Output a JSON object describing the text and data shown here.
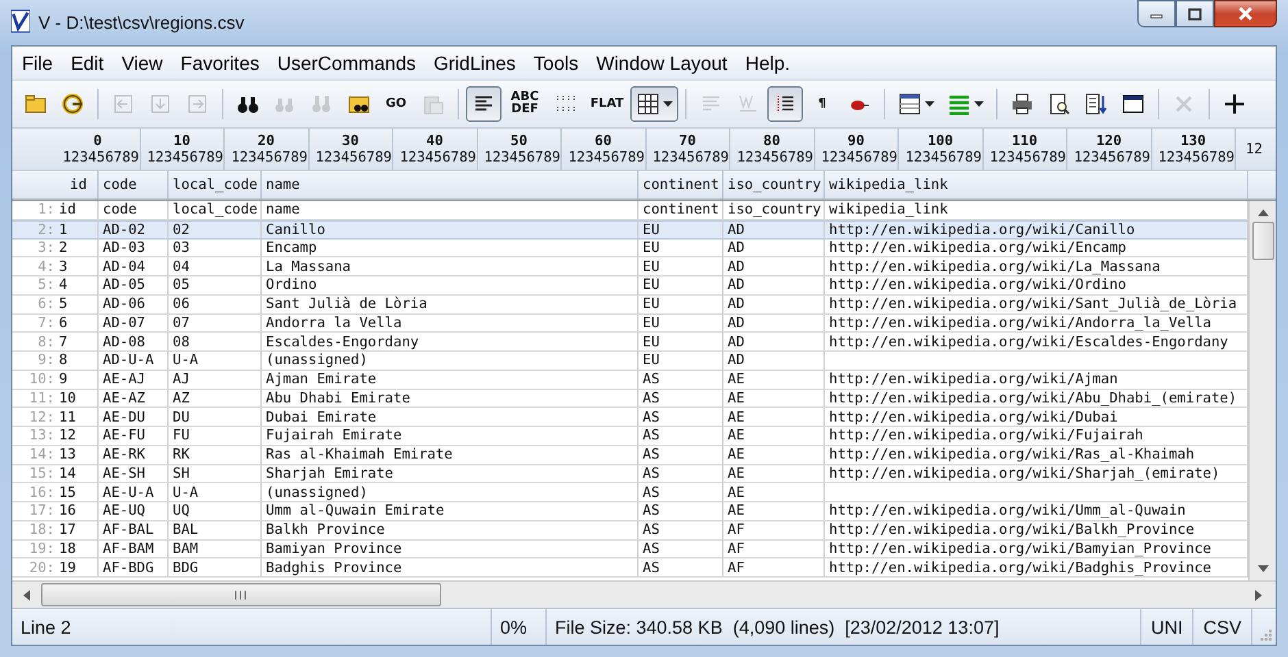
{
  "window": {
    "title": "V - D:\\test\\csv\\regions.csv"
  },
  "menu": [
    "File",
    "Edit",
    "View",
    "Favorites",
    "UserCommands",
    "GridLines",
    "Tools",
    "Window Layout",
    "Help."
  ],
  "toolbar": [
    {
      "kind": "icon",
      "disabled": false,
      "pressed": false
    },
    {
      "kind": "icon",
      "disabled": false,
      "pressed": false
    },
    {
      "kind": "separator"
    },
    {
      "kind": "icon",
      "disabled": true,
      "pressed": false
    },
    {
      "kind": "icon",
      "disabled": true,
      "pressed": false
    },
    {
      "kind": "icon",
      "disabled": true,
      "pressed": false
    },
    {
      "kind": "separator"
    },
    {
      "kind": "icon",
      "disabled": false,
      "pressed": false
    },
    {
      "kind": "icon",
      "disabled": true,
      "pressed": false
    },
    {
      "kind": "icon",
      "disabled": true,
      "pressed": false
    },
    {
      "kind": "icon",
      "disabled": false,
      "pressed": false
    },
    {
      "kind": "text",
      "label": "GO",
      "disabled": false,
      "pressed": false
    },
    {
      "kind": "icon",
      "disabled": true,
      "pressed": false
    },
    {
      "kind": "separator"
    },
    {
      "kind": "icon",
      "disabled": false,
      "pressed": true
    },
    {
      "kind": "text",
      "label": "ABC DEF",
      "disabled": false,
      "pressed": false
    },
    {
      "kind": "icon",
      "disabled": false,
      "pressed": false
    },
    {
      "kind": "text",
      "label": "FLAT",
      "disabled": false,
      "pressed": false
    },
    {
      "kind": "dropdown",
      "disabled": false,
      "pressed": true
    },
    {
      "kind": "separator"
    },
    {
      "kind": "icon",
      "disabled": true,
      "pressed": false
    },
    {
      "kind": "icon",
      "disabled": true,
      "pressed": false
    },
    {
      "kind": "icon",
      "disabled": false,
      "pressed": true
    },
    {
      "kind": "text",
      "label": "¶",
      "disabled": false,
      "pressed": false
    },
    {
      "kind": "icon",
      "disabled": false,
      "pressed": false
    },
    {
      "kind": "separator"
    },
    {
      "kind": "dropdown",
      "disabled": false,
      "pressed": false
    },
    {
      "kind": "dropdown",
      "disabled": false,
      "pressed": false
    },
    {
      "kind": "separator"
    },
    {
      "kind": "icon",
      "disabled": false,
      "pressed": false
    },
    {
      "kind": "icon",
      "disabled": false,
      "pressed": false
    },
    {
      "kind": "icon",
      "disabled": false,
      "pressed": false
    },
    {
      "kind": "icon",
      "disabled": false,
      "pressed": false
    },
    {
      "kind": "separator"
    },
    {
      "kind": "icon",
      "disabled": true,
      "pressed": false
    },
    {
      "kind": "separator"
    },
    {
      "kind": "icon",
      "disabled": false,
      "pressed": false
    }
  ],
  "ruler": [
    {
      "label": "0",
      "digits": "123456789"
    },
    {
      "label": "10",
      "digits": "123456789"
    },
    {
      "label": "20",
      "digits": "123456789"
    },
    {
      "label": "30",
      "digits": "123456789"
    },
    {
      "label": "40",
      "digits": "123456789"
    },
    {
      "label": "50",
      "digits": "123456789"
    },
    {
      "label": "60",
      "digits": "123456789"
    },
    {
      "label": "70",
      "digits": "123456789"
    },
    {
      "label": "80",
      "digits": "123456789"
    },
    {
      "label": "90",
      "digits": "123456789"
    },
    {
      "label": "100",
      "digits": "123456789"
    },
    {
      "label": "110",
      "digits": "123456789"
    },
    {
      "label": "120",
      "digits": "123456789"
    },
    {
      "label": "130",
      "digits": "123456789"
    },
    {
      "digits": "12"
    }
  ],
  "table": {
    "columns": [
      "id",
      "code",
      "local_code",
      "name",
      "continent",
      "iso_country",
      "wikipedia_link"
    ],
    "rows": [
      {
        "line": "1:",
        "selected": false,
        "cells": [
          "id",
          "code",
          "local_code",
          "name",
          "continent",
          "iso_country",
          "wikipedia_link"
        ]
      },
      {
        "line": "2:",
        "selected": true,
        "cells": [
          "1",
          "AD-02",
          "02",
          "Canillo",
          "EU",
          "AD",
          "http://en.wikipedia.org/wiki/Canillo"
        ]
      },
      {
        "line": "3:",
        "selected": false,
        "cells": [
          "2",
          "AD-03",
          "03",
          "Encamp",
          "EU",
          "AD",
          "http://en.wikipedia.org/wiki/Encamp"
        ]
      },
      {
        "line": "4:",
        "selected": false,
        "cells": [
          "3",
          "AD-04",
          "04",
          "La Massana",
          "EU",
          "AD",
          "http://en.wikipedia.org/wiki/La_Massana"
        ]
      },
      {
        "line": "5:",
        "selected": false,
        "cells": [
          "4",
          "AD-05",
          "05",
          "Ordino",
          "EU",
          "AD",
          "http://en.wikipedia.org/wiki/Ordino"
        ]
      },
      {
        "line": "6:",
        "selected": false,
        "cells": [
          "5",
          "AD-06",
          "06",
          "Sant Julià de Lòria",
          "EU",
          "AD",
          "http://en.wikipedia.org/wiki/Sant_Julià_de_Lòria"
        ]
      },
      {
        "line": "7:",
        "selected": false,
        "cells": [
          "6",
          "AD-07",
          "07",
          "Andorra la Vella",
          "EU",
          "AD",
          "http://en.wikipedia.org/wiki/Andorra_la_Vella"
        ]
      },
      {
        "line": "8:",
        "selected": false,
        "cells": [
          "7",
          "AD-08",
          "08",
          "Escaldes-Engordany",
          "EU",
          "AD",
          "http://en.wikipedia.org/wiki/Escaldes-Engordany"
        ]
      },
      {
        "line": "9:",
        "selected": false,
        "cells": [
          "8",
          "AD-U-A",
          "U-A",
          "(unassigned)",
          "EU",
          "AD"
        ]
      },
      {
        "line": "10:",
        "selected": false,
        "cells": [
          "9",
          "AE-AJ",
          "AJ",
          "Ajman Emirate",
          "AS",
          "AE",
          "http://en.wikipedia.org/wiki/Ajman"
        ]
      },
      {
        "line": "11:",
        "selected": false,
        "cells": [
          "10",
          "AE-AZ",
          "AZ",
          "Abu Dhabi Emirate",
          "AS",
          "AE",
          "http://en.wikipedia.org/wiki/Abu_Dhabi_(emirate)"
        ]
      },
      {
        "line": "12:",
        "selected": false,
        "cells": [
          "11",
          "AE-DU",
          "DU",
          "Dubai Emirate",
          "AS",
          "AE",
          "http://en.wikipedia.org/wiki/Dubai"
        ]
      },
      {
        "line": "13:",
        "selected": false,
        "cells": [
          "12",
          "AE-FU",
          "FU",
          "Fujairah Emirate",
          "AS",
          "AE",
          "http://en.wikipedia.org/wiki/Fujairah"
        ]
      },
      {
        "line": "14:",
        "selected": false,
        "cells": [
          "13",
          "AE-RK",
          "RK",
          "Ras al-Khaimah Emirate",
          "AS",
          "AE",
          "http://en.wikipedia.org/wiki/Ras_al-Khaimah"
        ]
      },
      {
        "line": "15:",
        "selected": false,
        "cells": [
          "14",
          "AE-SH",
          "SH",
          "Sharjah Emirate",
          "AS",
          "AE",
          "http://en.wikipedia.org/wiki/Sharjah_(emirate)"
        ]
      },
      {
        "line": "16:",
        "selected": false,
        "cells": [
          "15",
          "AE-U-A",
          "U-A",
          "(unassigned)",
          "AS",
          "AE"
        ]
      },
      {
        "line": "17:",
        "selected": false,
        "cells": [
          "16",
          "AE-UQ",
          "UQ",
          "Umm al-Quwain Emirate",
          "AS",
          "AE",
          "http://en.wikipedia.org/wiki/Umm_al-Quwain"
        ]
      },
      {
        "line": "18:",
        "selected": false,
        "cells": [
          "17",
          "AF-BAL",
          "BAL",
          "Balkh Province",
          "AS",
          "AF",
          "http://en.wikipedia.org/wiki/Balkh_Province"
        ]
      },
      {
        "line": "19:",
        "selected": false,
        "cells": [
          "18",
          "AF-BAM",
          "BAM",
          "Bamiyan Province",
          "AS",
          "AF",
          "http://en.wikipedia.org/wiki/Bamyian_Province"
        ]
      },
      {
        "line": "20:",
        "selected": false,
        "cells": [
          "19",
          "AF-BDG",
          "BDG",
          "Badghis Province",
          "AS",
          "AF",
          "http://en.wikipedia.org/wiki/Badghis_Province"
        ]
      }
    ]
  },
  "hscroll_grip": "III",
  "status_bar": [
    "Line 2",
    "0%",
    "File Size: 340.58 KB  (4,090 lines)  [23/02/2012 13:07]",
    "UNI",
    "CSV"
  ]
}
